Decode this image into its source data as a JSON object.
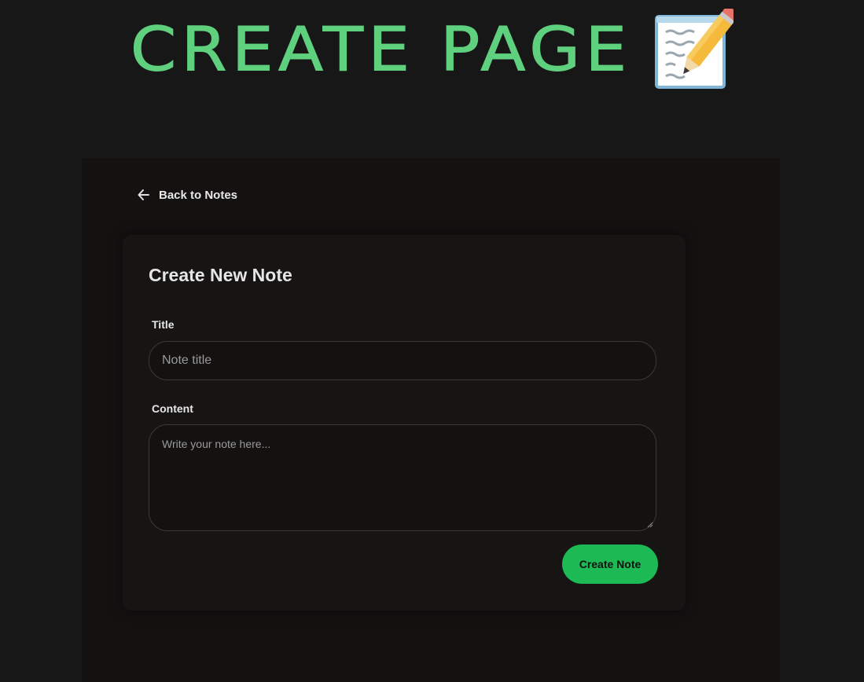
{
  "banner": {
    "title": "CREATE PAGE",
    "icon": "memo-icon",
    "title_color": "#5fd07e"
  },
  "nav": {
    "back_label": "Back to Notes",
    "back_icon": "arrow-left-icon"
  },
  "form": {
    "heading": "Create New Note",
    "title_label": "Title",
    "title_placeholder": "Note title",
    "title_value": "",
    "content_label": "Content",
    "content_placeholder": "Write your note here...",
    "content_value": "",
    "submit_label": "Create Note"
  },
  "colors": {
    "page_background": "#171717",
    "app_background": "#141111",
    "card_background": "#171414",
    "accent": "#1db954",
    "input_border": "#3a3838"
  }
}
